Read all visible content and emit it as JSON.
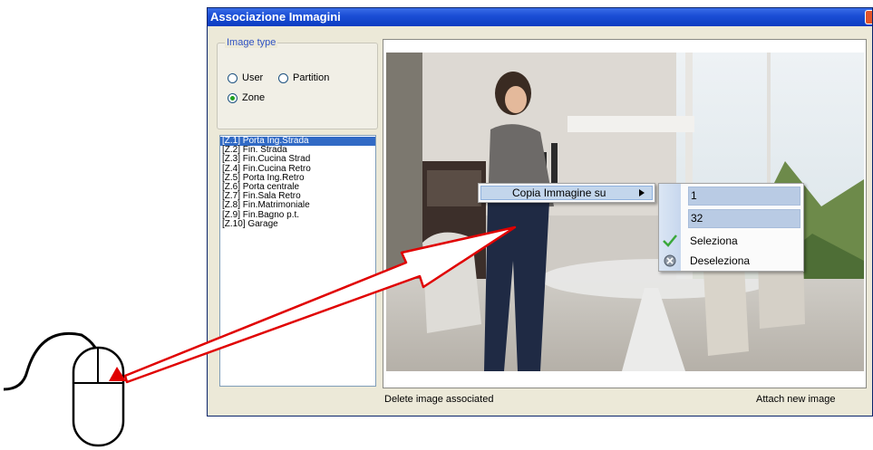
{
  "window": {
    "title": "Associazione Immagini"
  },
  "image_type": {
    "legend": "Image type",
    "options": [
      {
        "label": "User",
        "checked": false
      },
      {
        "label": "Partition",
        "checked": false
      },
      {
        "label": "Zone",
        "checked": true
      }
    ]
  },
  "zones": {
    "items": [
      "[Z.1] Porta Ing.Strada",
      "[Z.2] Fin. Strada",
      "[Z.3] Fin.Cucina Strad",
      "[Z.4] Fin.Cucina Retro",
      "[Z.5] Porta Ing.Retro",
      "[Z.6] Porta centrale",
      "[Z.7] Fin.Sala Retro",
      "[Z.8] Fin.Matrimoniale",
      "[Z.9] Fin.Bagno p.t.",
      "[Z.10] Garage"
    ],
    "selected_index": 0
  },
  "context_menu": {
    "item_label": "Copia Immagine su",
    "submenu": [
      {
        "label": "1",
        "icon": "",
        "highlight": true
      },
      {
        "label": "32",
        "icon": "",
        "highlight": true
      },
      {
        "label": "Seleziona",
        "icon": "checkmark-icon",
        "highlight": false
      },
      {
        "label": "Deseleziona",
        "icon": "clear-icon",
        "highlight": false
      }
    ]
  },
  "footer": {
    "delete_label": "Delete image associated",
    "attach_label": "Attach new image"
  },
  "colors": {
    "titlebar": "#0b3cc1",
    "selection": "#316ac5",
    "annotation_arrow": "#e00000"
  }
}
